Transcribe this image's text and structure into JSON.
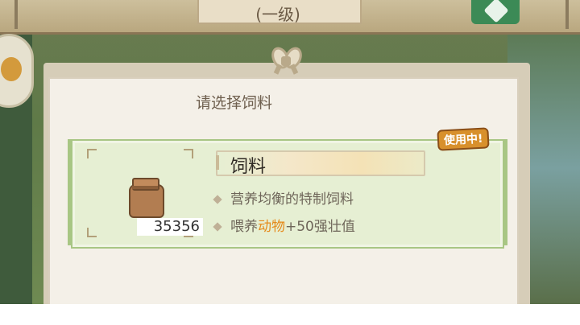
{
  "topbar": {
    "title": "(一级)"
  },
  "dialog": {
    "title": "请选择饲料"
  },
  "item": {
    "name": "饲料",
    "count": "35356",
    "status_badge": "使用中!",
    "description_1": "营养均衡的特制饲料",
    "description_2_prefix": "喂养",
    "description_2_highlight": "动物",
    "description_2_suffix": "+50强壮值"
  },
  "icons": [
    "shovel-icon",
    "gold-coin-icon",
    "rope-knot-icon",
    "feed-bag-icon"
  ],
  "colors": {
    "highlight": "#e58a1a",
    "card_bg": "#e6efd3",
    "card_border": "#a8c684",
    "badge": "#d8902c"
  }
}
